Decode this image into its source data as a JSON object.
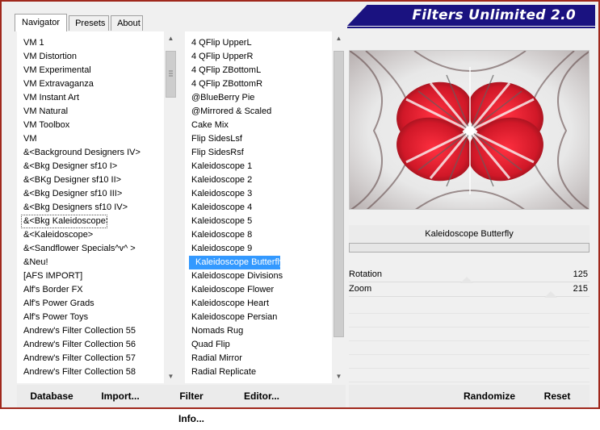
{
  "app": {
    "title": "Filters Unlimited 2.0"
  },
  "tabs": [
    {
      "label": "Navigator",
      "active": true
    },
    {
      "label": "Presets",
      "active": false
    },
    {
      "label": "About",
      "active": false
    }
  ],
  "categories": [
    "VM 1",
    "VM Distortion",
    "VM Experimental",
    "VM Extravaganza",
    "VM Instant Art",
    "VM Natural",
    "VM Toolbox",
    "VM",
    "&<Background Designers IV>",
    "&<Bkg Designer sf10 I>",
    "&<BKg Designer sf10 II>",
    "&<Bkg Designer sf10 III>",
    "&<Bkg Designers sf10 IV>",
    "&<Bkg Kaleidoscope>",
    "&<Kaleidoscope>",
    "&<Sandflower Specials^v^ >",
    "&Neu!",
    "[AFS IMPORT]",
    "Alf's Border FX",
    "Alf's Power Grads",
    "Alf's Power Toys",
    "Andrew's Filter Collection 55",
    "Andrew's Filter Collection 56",
    "Andrew's Filter Collection 57",
    "Andrew's Filter Collection 58"
  ],
  "focused_category": "&<Bkg Kaleidoscope>",
  "filters": [
    "4 QFlip UpperL",
    "4 QFlip UpperR",
    "4 QFlip ZBottomL",
    "4 QFlip ZBottomR",
    "@BlueBerry Pie",
    "@Mirrored & Scaled",
    "Cake Mix",
    "Flip SidesLsf",
    "Flip SidesRsf",
    "Kaleidoscope 1",
    "Kaleidoscope 2",
    "Kaleidoscope 3",
    "Kaleidoscope 4",
    "Kaleidoscope 5",
    "Kaleidoscope 8",
    "Kaleidoscope 9",
    "Kaleidoscope Butterfly",
    "Kaleidoscope Divisions",
    "Kaleidoscope Flower",
    "Kaleidoscope Heart",
    "Kaleidoscope Persian",
    "Nomads Rug",
    "Quad Flip",
    "Radial Mirror",
    "Radial Replicate"
  ],
  "selected_filter": "Kaleidoscope Butterfly",
  "preview": {
    "filter_name": "Kaleidoscope Butterfly"
  },
  "sliders": [
    {
      "label": "Rotation",
      "value": "125",
      "fraction": 0.49
    },
    {
      "label": "Zoom",
      "value": "215",
      "fraction": 0.84
    }
  ],
  "buttons": {
    "database": "Database",
    "import": "Import...",
    "filter_info": "Filter Info...",
    "editor": "Editor...",
    "randomize": "Randomize",
    "reset": "Reset"
  },
  "colors": {
    "title_bg": "#1a1280",
    "frame": "#a0281c",
    "selection": "#3399ff",
    "preview_red": "#e0202c"
  }
}
